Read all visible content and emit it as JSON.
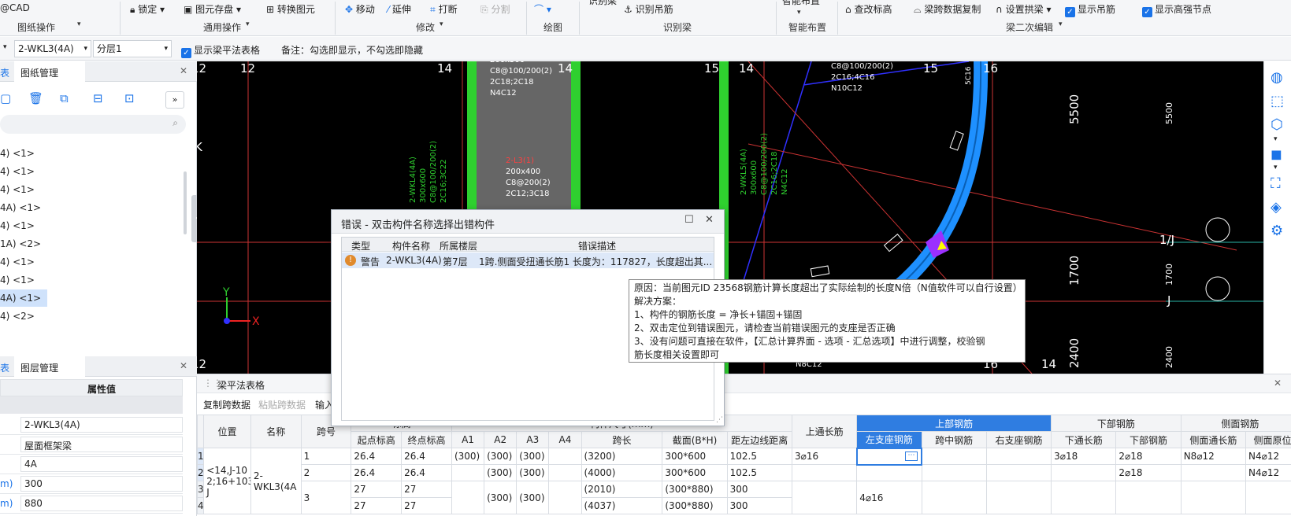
{
  "ribbon": {
    "app_label": "@CAD",
    "group_tuzhi": "图纸操作",
    "lock": "锁定",
    "save_element": "图元存盘",
    "convert_element": "转换图元",
    "group_common": "通用操作",
    "move": "移动",
    "extend": "延伸",
    "break": "打断",
    "split": "分割",
    "group_modify": "修改",
    "group_draw": "绘图",
    "recognize_beam_top": "识别梁",
    "recognize_hanger": "识别吊筋",
    "group_recognize": "识别梁",
    "smart_layout_top": "智能布置",
    "group_smart": "智能布置",
    "check_elevation": "查改标高",
    "copy_span": "梁跨数据复制",
    "set_arch": "设置拱梁",
    "show_hanger": "显示吊筋",
    "show_high_node": "显示高强节点",
    "group_second_edit": "梁二次编辑"
  },
  "toolbar2": {
    "beam_select": "2-WKL3(4A)",
    "layer_select": "分层1",
    "show_table": "显示梁平法表格",
    "note": "备注：勾选即显示，不勾选即隐藏"
  },
  "left_panel": {
    "tab_left_cut": "表",
    "tab_drawing": "图纸管理",
    "items": [
      "4) <1>",
      "4) <1>",
      "4) <1>",
      "4A) <1>",
      "4) <1>",
      "1A) <2>",
      "4) <1>",
      "4) <1>",
      "4A) <1>",
      "4) <2>"
    ]
  },
  "prop_panel": {
    "tab_left_cut": "表",
    "tab_layer": "图层管理",
    "col_value": "属性值",
    "rows": [
      {
        "label": "",
        "value": "2-WKL3(4A)"
      },
      {
        "label": "",
        "value": "屋面框架梁"
      },
      {
        "label": "",
        "value": "4A"
      },
      {
        "label": "m)",
        "value": "300"
      },
      {
        "label": "m)",
        "value": "880"
      }
    ]
  },
  "cad": {
    "axis_labels": [
      "12",
      "12",
      "14",
      "14",
      "15",
      "14",
      "15",
      "16",
      "K",
      "J",
      "12",
      "16",
      "14",
      "1/J",
      "J"
    ],
    "dims": [
      "5500",
      "1700",
      "2400",
      "5500",
      "1700",
      "2400"
    ],
    "beam_text_1": [
      "200x500",
      "C8@100/200(2)",
      "2C18;2C18",
      "N4C12"
    ],
    "beam_text_2": [
      "2-L3(1)",
      "200x400",
      "C8@200(2)",
      "2C12;3C18"
    ],
    "beam_text_3": [
      "C8@100/200(2)",
      "2C16;4C16",
      "N10C12"
    ],
    "beam_text_4": [
      "2-WKL4(4A)",
      "300x600",
      "C8@100/200(2)",
      "2C16;3C22"
    ],
    "beam_text_5": [
      "2-WKL5(4A)",
      "300x600",
      "C8@100/200(2)",
      "2C16;2C18",
      "N4C12"
    ],
    "beam_text_6": [
      "5C16"
    ],
    "beam_text_7": [
      "N8C12"
    ]
  },
  "dialog": {
    "title": "错误 - 双击构件名称选择出错构件",
    "col_type": "类型",
    "col_name": "构件名称",
    "col_layer": "所属楼层",
    "col_desc": "错误描述",
    "row": {
      "type": "警告",
      "name": "2-WKL3(4A)",
      "layer": "第7层",
      "desc": "1跨.侧面受扭通长筋1 长度为：117827，长度超出其..."
    }
  },
  "tooltip": {
    "lines": [
      "原因：当前图元ID 23568钢筋计算长度超出了实际绘制的长度N倍（N值软件可以自行设置）",
      "解决方案：",
      "1、构件的钢筋长度 = 净长+锚固+锚固",
      "2、双击定位到错误图元，请检查当前错误图元的支座是否正确",
      "3、没有问题可直接在软件，【汇总计算界面 - 选项 - 汇总选项】中进行调整，校验钢",
      "筋长度相关设置即可"
    ]
  },
  "beam_table": {
    "title": "梁平法表格",
    "copy_span": "复制跨数据",
    "paste_span": "粘贴跨数据",
    "input": "输入",
    "h_position": "位置",
    "h_name": "名称",
    "h_span_no": "跨号",
    "h_elev": "标高",
    "h_start_elev": "起点标高",
    "h_end_elev": "终点标高",
    "h_size": "构件尺寸(mm)",
    "h_a1": "A1",
    "h_a2": "A2",
    "h_a3": "A3",
    "h_a4": "A4",
    "h_span_len": "跨长",
    "h_section": "截面(B*H)",
    "h_edge": "距左边线距离",
    "h_top_through": "上通长筋",
    "h_top_rebar": "上部钢筋",
    "h_left_support": "左支座钢筋",
    "h_mid": "跨中钢筋",
    "h_right_support": "右支座钢筋",
    "h_bottom": "下部钢筋",
    "h_bottom_through": "下通长筋",
    "h_bottom_rebar": "下部钢筋",
    "h_side": "侧面钢筋",
    "h_side_through": "侧面通长筋",
    "h_side_orig": "侧面原位",
    "row_nums": [
      "1",
      "2",
      "3",
      "4"
    ],
    "position": "<14,J-10\n2;16+103\nJ",
    "name": "2-\nWKL3(4A",
    "rows": [
      {
        "span": "1",
        "start": "26.4",
        "end": "26.4",
        "a1": "(300)",
        "a2": "(300)",
        "a3": "(300)",
        "a4": "",
        "len": "(3200)",
        "section": "300*600",
        "edge": "102.5",
        "top_through": "3⌀16",
        "left": "",
        "mid": "",
        "right": "",
        "bottom_through": "3⌀18",
        "bottom": "2⌀18",
        "side_through": "N8⌀12",
        "side_orig": "N4⌀12"
      },
      {
        "span": "2",
        "start": "26.4",
        "end": "26.4",
        "a1": "",
        "a2": "(300)",
        "a3": "(300)",
        "a4": "",
        "len": "(4000)",
        "section": "300*600",
        "edge": "102.5",
        "top_through": "",
        "left": "",
        "mid": "",
        "right": "",
        "bottom_through": "",
        "bottom": "2⌀18",
        "side_through": "",
        "side_orig": "N4⌀12"
      },
      {
        "span": "3",
        "start": "27",
        "end": "27",
        "a1": "",
        "a2": "(300)",
        "a3": "(300)",
        "a4": "",
        "len": "(2010)",
        "section": "(300*880)",
        "edge": "300",
        "top_through": "",
        "left": "4⌀16",
        "mid": "",
        "right": "",
        "bottom_through": "",
        "bottom": "",
        "side_through": "",
        "side_orig": ""
      },
      {
        "span": "",
        "start": "27",
        "end": "27",
        "a1": "",
        "a2": "",
        "a3": "",
        "a4": "",
        "len": "(4037)",
        "section": "(300*880)",
        "edge": "300",
        "top_through": "",
        "left": "",
        "mid": "",
        "right": "",
        "bottom_through": "",
        "bottom": "",
        "side_through": "",
        "side_orig": ""
      }
    ]
  }
}
